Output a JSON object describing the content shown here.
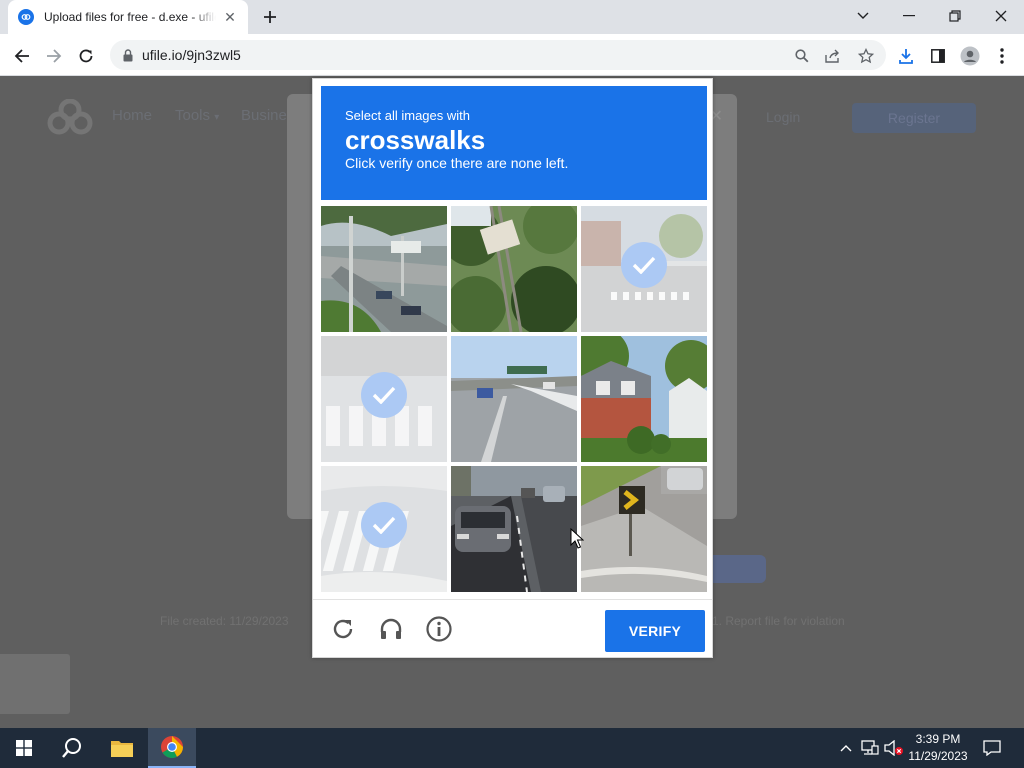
{
  "browser": {
    "tab_title": "Upload files for free - d.exe - ufile.io",
    "url": "ufile.io/9jn3zwl5"
  },
  "site": {
    "nav": [
      "Home",
      "Tools",
      "Business"
    ],
    "tools_has_dropdown": true,
    "login": "Login",
    "register": "Register",
    "footer_left": "File created: 11/29/2023",
    "footer_right": "1. Report file for violation"
  },
  "captcha": {
    "prompt_top": "Select all images with",
    "prompt_target": "crosswalks",
    "prompt_bottom": "Click verify once there are none left.",
    "verify_label": "VERIFY",
    "tiles": [
      {
        "id": 1,
        "selected": false
      },
      {
        "id": 2,
        "selected": false
      },
      {
        "id": 3,
        "selected": true
      },
      {
        "id": 4,
        "selected": true
      },
      {
        "id": 5,
        "selected": false
      },
      {
        "id": 6,
        "selected": false
      },
      {
        "id": 7,
        "selected": true
      },
      {
        "id": 8,
        "selected": false
      },
      {
        "id": 9,
        "selected": false
      }
    ],
    "footer_icons": [
      "reload-icon",
      "audio-icon",
      "info-icon"
    ]
  },
  "taskbar": {
    "time": "3:39 PM",
    "date": "11/29/2023"
  },
  "colors": {
    "captcha_blue": "#1a73e8",
    "taskbar": "#1f2b3a"
  }
}
